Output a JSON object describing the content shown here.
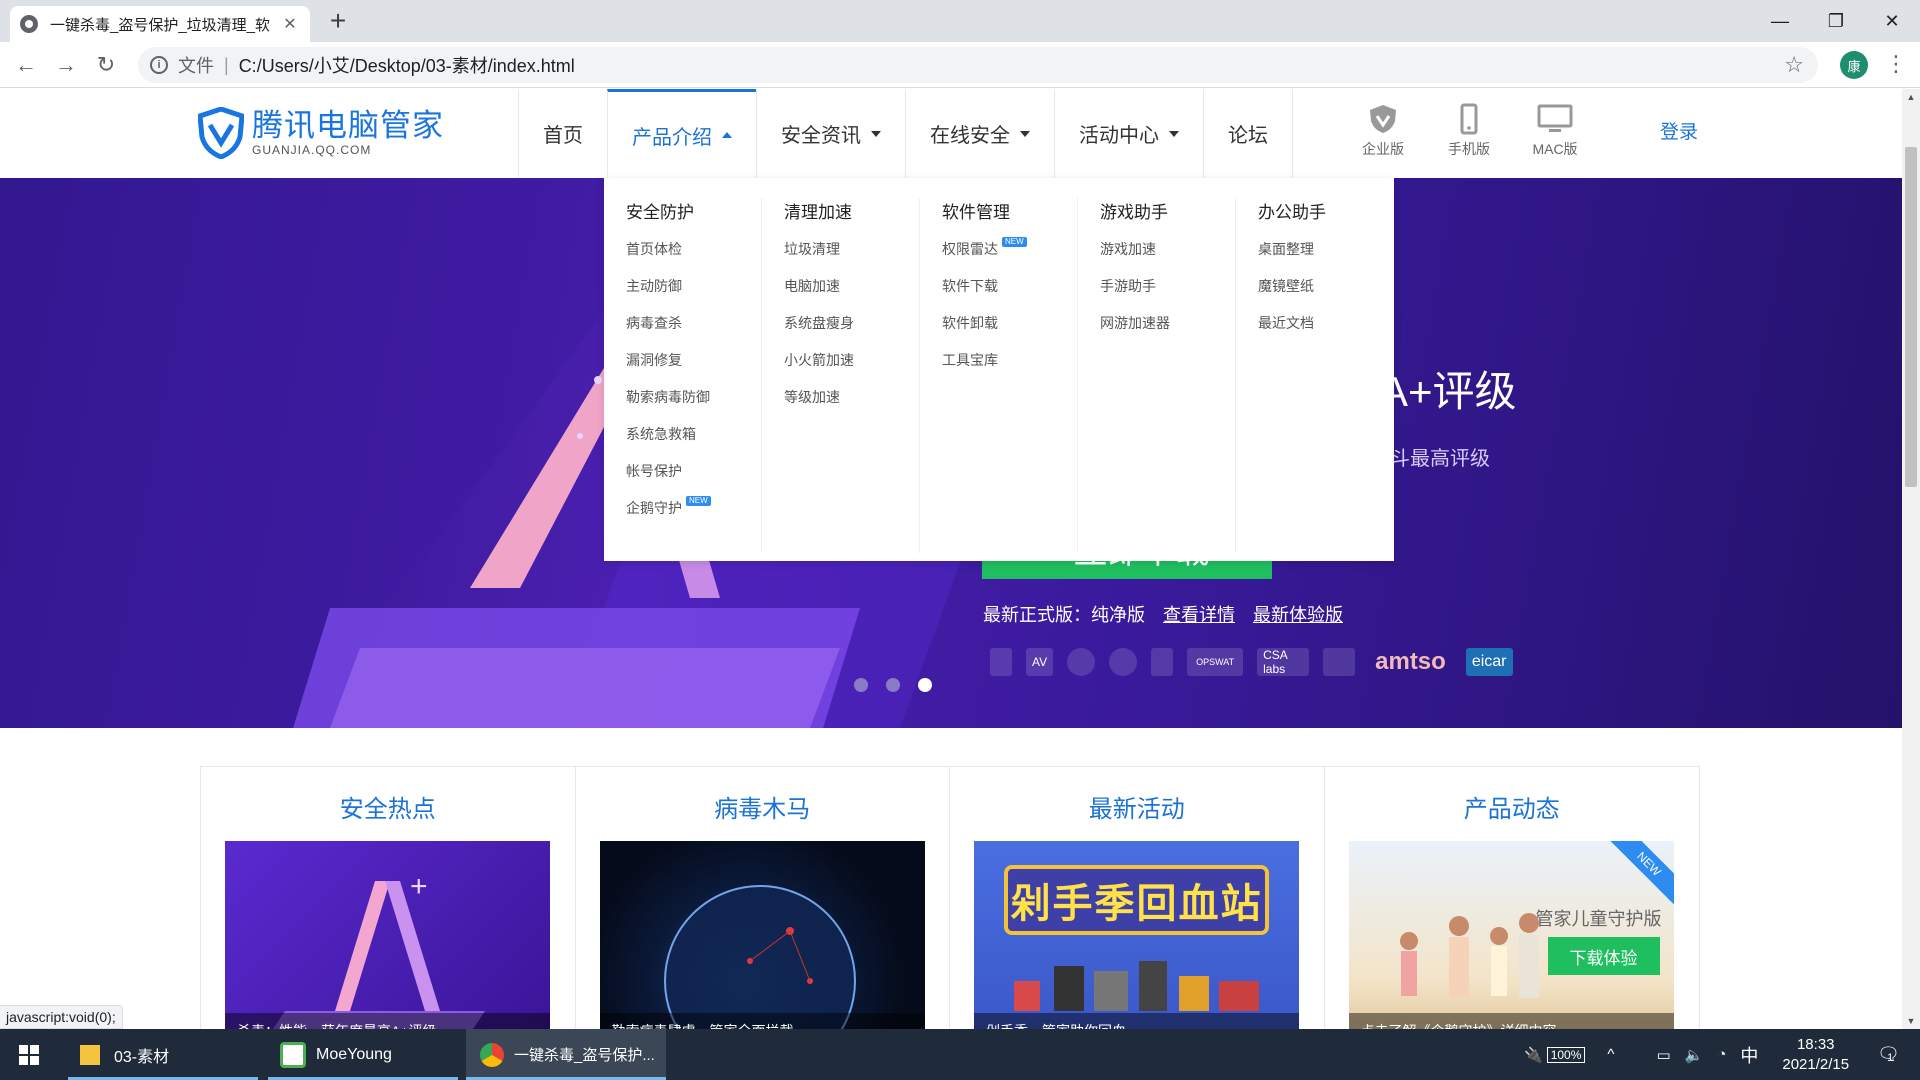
{
  "browser": {
    "tab_title": "一键杀毒_盗号保护_垃圾清理_软",
    "new_tab": "+",
    "url_label": "文件",
    "url_sep": "|",
    "url": "C:/Users/小艾/Desktop/03-素材/index.html",
    "profile_initial": "康",
    "window_controls": [
      "—",
      "❐",
      "✕"
    ]
  },
  "header": {
    "logo_cn": "腾讯电脑管家",
    "logo_en": "GUANJIA.QQ.COM",
    "nav": [
      {
        "label": "首页",
        "has_caret": false,
        "active": false
      },
      {
        "label": "产品介绍",
        "has_caret": true,
        "active": true
      },
      {
        "label": "安全资讯",
        "has_caret": true,
        "active": false
      },
      {
        "label": "在线安全",
        "has_caret": true,
        "active": false
      },
      {
        "label": "活动中心",
        "has_caret": true,
        "active": false
      },
      {
        "label": "论坛",
        "has_caret": false,
        "active": false
      }
    ],
    "versions": [
      {
        "label": "企业版",
        "icon": "shield-icon"
      },
      {
        "label": "手机版",
        "icon": "phone-icon"
      },
      {
        "label": "MAC版",
        "icon": "monitor-icon"
      }
    ],
    "login": "登录"
  },
  "dropdown": {
    "columns": [
      {
        "title": "安全防护",
        "items": [
          {
            "label": "首页体检",
            "new": false
          },
          {
            "label": "主动防御",
            "new": false
          },
          {
            "label": "病毒查杀",
            "new": false
          },
          {
            "label": "漏洞修复",
            "new": false
          },
          {
            "label": "勒索病毒防御",
            "new": false
          },
          {
            "label": "系统急救箱",
            "new": false
          },
          {
            "label": "帐号保护",
            "new": false
          },
          {
            "label": "企鹅守护",
            "new": true
          }
        ]
      },
      {
        "title": "清理加速",
        "items": [
          {
            "label": "垃圾清理",
            "new": false
          },
          {
            "label": "电脑加速",
            "new": false
          },
          {
            "label": "系统盘瘦身",
            "new": false
          },
          {
            "label": "小火箭加速",
            "new": false
          },
          {
            "label": "等级加速",
            "new": false
          }
        ]
      },
      {
        "title": "软件管理",
        "items": [
          {
            "label": "权限雷达",
            "new": true
          },
          {
            "label": "软件下载",
            "new": false
          },
          {
            "label": "软件卸载",
            "new": false
          },
          {
            "label": "工具宝库",
            "new": false
          }
        ]
      },
      {
        "title": "游戏助手",
        "items": [
          {
            "label": "游戏加速",
            "new": false
          },
          {
            "label": "手游助手",
            "new": false
          },
          {
            "label": "网游加速器",
            "new": false
          }
        ]
      },
      {
        "title": "办公助手",
        "items": [
          {
            "label": "桌面整理",
            "new": false
          },
          {
            "label": "魔镜壁纸",
            "new": false
          },
          {
            "label": "最近文档",
            "new": false
          }
        ]
      }
    ],
    "new_tag": "NEW"
  },
  "hero": {
    "title_visible": "A+评级",
    "subtitle_visible": "斗最高评级",
    "download_visible": "立即下载",
    "version_prefix": "最新正式版：纯净版",
    "details_link": "查看详情",
    "beta_link": "最新体验版",
    "cert_badges": [
      "AV",
      "OPSWAT",
      "CSA labs",
      "amtso",
      "eicar"
    ],
    "carousel_dots": 3,
    "active_dot": 3
  },
  "sections": [
    {
      "title": "安全热点",
      "caption": "杀毒：性能，获年度最高A+评级"
    },
    {
      "title": "病毒木马",
      "caption": "勒索病毒肆虐，管家全面拦截"
    },
    {
      "title": "最新活动",
      "caption": "剁手季，管家助你回血",
      "banner": "剁手季回血站"
    },
    {
      "title": "产品动态",
      "caption": "点击了解《企鹅守护》详细内容",
      "promo_label": "管家儿童守护版",
      "promo_button": "下载体验",
      "corner_tag": "NEW"
    }
  ],
  "status_bar": "javascript:void(0);",
  "taskbar": {
    "items": [
      {
        "label": "03-素材",
        "icon": "folder-icon"
      },
      {
        "label": "MoeYoung",
        "icon": "moeyoung-icon"
      },
      {
        "label": "一键杀毒_盗号保护...",
        "icon": "chrome-icon"
      }
    ],
    "battery": "100%",
    "ime": "中",
    "time": "18:33",
    "date": "2021/2/15",
    "notification_count": "1"
  }
}
